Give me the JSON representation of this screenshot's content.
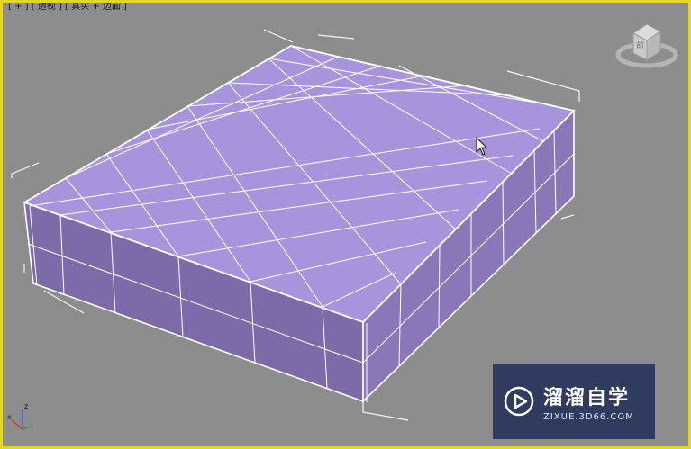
{
  "viewport": {
    "label": "[ + ] [ 透视 ] [ 真实 + 边面 ]",
    "border_color": "#e2d628",
    "background_color": "#8d8d8d"
  },
  "object": {
    "type": "box",
    "fill_color": "#a993dd",
    "side_color": "#8a79bd",
    "wire_color": "#ffffff"
  },
  "viewcube": {
    "icon": "viewcube-icon",
    "face_label": "前"
  },
  "axis_tripod": {
    "icon": "axis-tripod-icon",
    "z": "z",
    "x": "x"
  },
  "cursor": {
    "icon": "mouse-pointer-icon"
  },
  "watermark": {
    "icon": "play-logo-icon",
    "title": "溜溜自学",
    "subtitle": "ZIXUE.3D66.COM"
  }
}
